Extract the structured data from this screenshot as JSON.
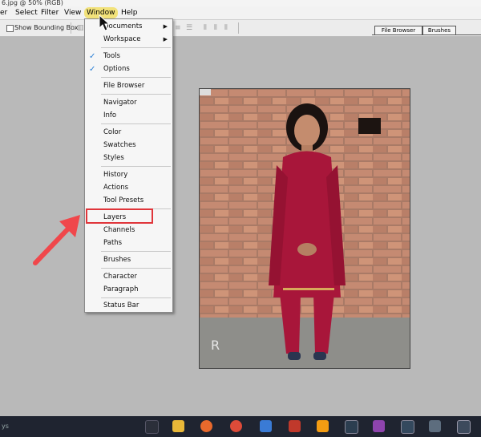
{
  "window": {
    "title": "6.jpg @ 50% (RGB)"
  },
  "menubar": {
    "items": [
      "er",
      "Select",
      "Filter",
      "View",
      "Window",
      "Help"
    ],
    "active": "Window"
  },
  "options_bar": {
    "show_bounding_box": "Show Bounding Box",
    "checked": false
  },
  "panel_tabs": [
    "File Browser",
    "Brushes"
  ],
  "window_menu": {
    "items": [
      {
        "label": "Documents",
        "submenu": true,
        "checked": false
      },
      {
        "label": "Workspace",
        "submenu": true,
        "checked": false
      },
      {
        "label": "Tools",
        "submenu": false,
        "checked": true
      },
      {
        "label": "Options",
        "submenu": false,
        "checked": true
      },
      {
        "label": "File Browser",
        "submenu": false,
        "checked": false
      },
      {
        "label": "Navigator",
        "submenu": false,
        "checked": false
      },
      {
        "label": "Info",
        "submenu": false,
        "checked": false
      },
      {
        "label": "Color",
        "submenu": false,
        "checked": false
      },
      {
        "label": "Swatches",
        "submenu": false,
        "checked": false
      },
      {
        "label": "Styles",
        "submenu": false,
        "checked": false
      },
      {
        "label": "History",
        "submenu": false,
        "checked": false
      },
      {
        "label": "Actions",
        "submenu": false,
        "checked": false
      },
      {
        "label": "Tool Presets",
        "submenu": false,
        "checked": false
      },
      {
        "label": "Layers",
        "submenu": false,
        "checked": false
      },
      {
        "label": "Channels",
        "submenu": false,
        "checked": false
      },
      {
        "label": "Paths",
        "submenu": false,
        "checked": false
      },
      {
        "label": "Brushes",
        "submenu": false,
        "checked": false
      },
      {
        "label": "Character",
        "submenu": false,
        "checked": false
      },
      {
        "label": "Paragraph",
        "submenu": false,
        "checked": false
      },
      {
        "label": "Status Bar",
        "submenu": false,
        "checked": false
      }
    ],
    "highlighted": "Layers"
  },
  "colors": {
    "highlight_box": "#e0353a",
    "annotation_arrow": "#f0474b",
    "check": "#2a7fd6",
    "dress": "#a8163a"
  },
  "taskbar": {
    "left_text": "ys"
  }
}
